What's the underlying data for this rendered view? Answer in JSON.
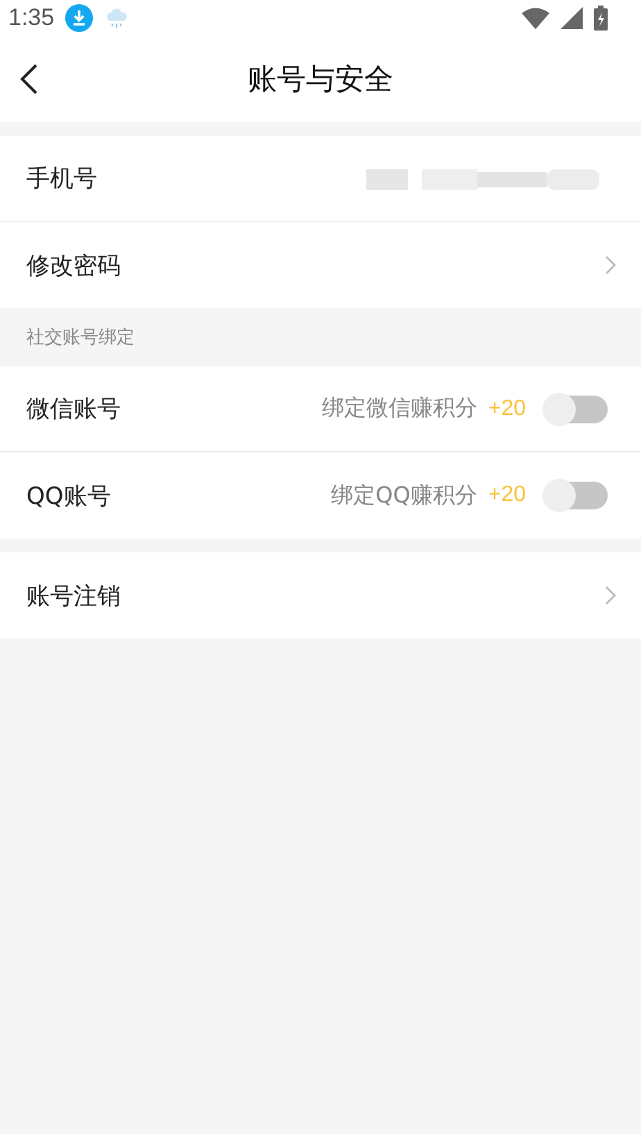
{
  "status_bar": {
    "time": "1:35"
  },
  "header": {
    "title": "账号与安全"
  },
  "sections": [
    {
      "items": [
        {
          "kind": "masked",
          "label": "手机号"
        },
        {
          "kind": "link",
          "label": "修改密码"
        }
      ]
    },
    {
      "title": "社交账号绑定",
      "items": [
        {
          "kind": "toggle",
          "label": "微信账号",
          "hint": "绑定微信赚积分",
          "bonus": "+20",
          "on": false
        },
        {
          "kind": "toggle",
          "label": "QQ账号",
          "hint": "绑定QQ赚积分",
          "bonus": "+20",
          "on": false
        }
      ]
    },
    {
      "items": [
        {
          "kind": "link",
          "label": "账号注销"
        }
      ]
    }
  ]
}
